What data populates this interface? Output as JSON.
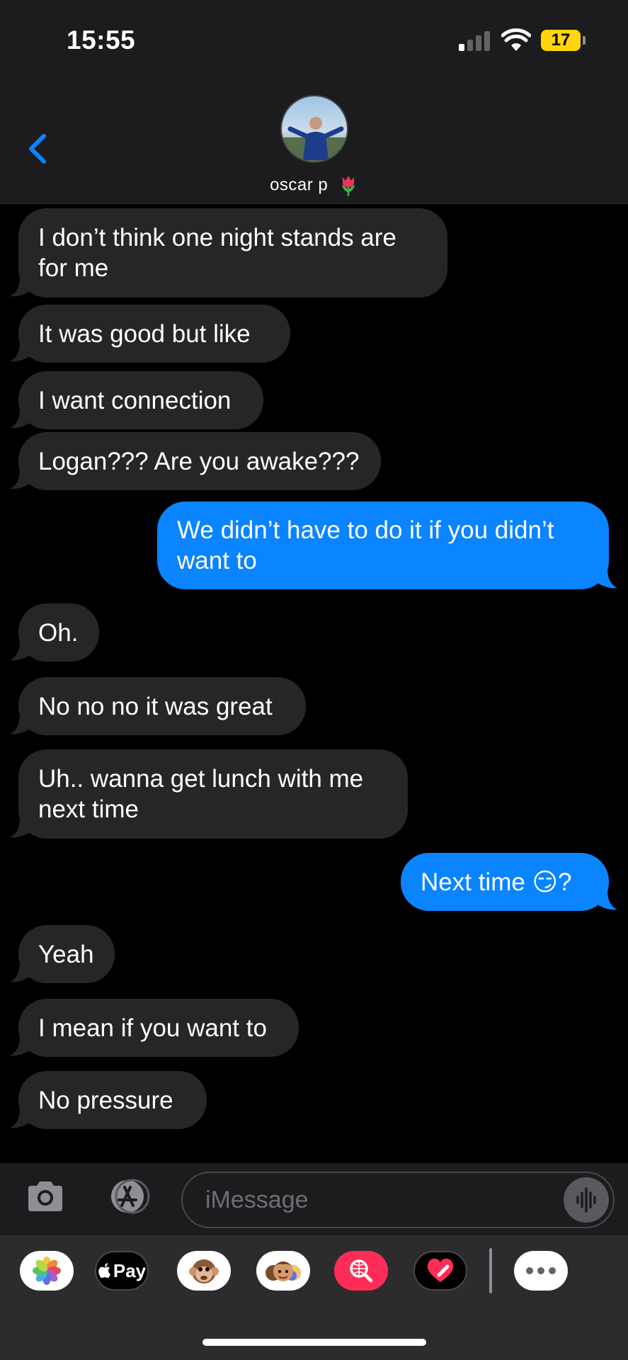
{
  "status_bar": {
    "time": "15:55",
    "battery_label": "17",
    "battery_color": "#ffd60a"
  },
  "header": {
    "contact_name": "oscar p",
    "contact_emoji": "tulip-icon"
  },
  "messages": [
    {
      "direction": "in",
      "text": "I don’t think one night stands are\nfor me"
    },
    {
      "direction": "in",
      "text": "It was good but like"
    },
    {
      "direction": "in",
      "text": "I want connection"
    },
    {
      "direction": "in",
      "text": "Logan??? Are you awake???"
    },
    {
      "direction": "out",
      "text": "We didn’t have to do it if you didn’t\nwant to"
    },
    {
      "direction": "in",
      "text": "Oh."
    },
    {
      "direction": "in",
      "text": "No no no it was great"
    },
    {
      "direction": "in",
      "text": "Uh.. wanna get lunch with me\nnext time"
    },
    {
      "direction": "out",
      "text": "Next time 😏?"
    },
    {
      "direction": "in",
      "text": "Yeah"
    },
    {
      "direction": "in",
      "text": "I mean if you want to"
    },
    {
      "direction": "in",
      "text": "No pressure"
    }
  ],
  "compose": {
    "placeholder": "iMessage"
  },
  "app_strip": {
    "items": [
      "photos-icon",
      "apple-pay-icon",
      "animoji-icon",
      "memoji-icon",
      "image-search-icon",
      "digital-touch-icon",
      "more-icon"
    ],
    "apple_pay_label": "Pay"
  },
  "colors": {
    "incoming_bubble": "#262628",
    "outgoing_bubble": "#0a84ff",
    "accent": "#0a84ff"
  }
}
